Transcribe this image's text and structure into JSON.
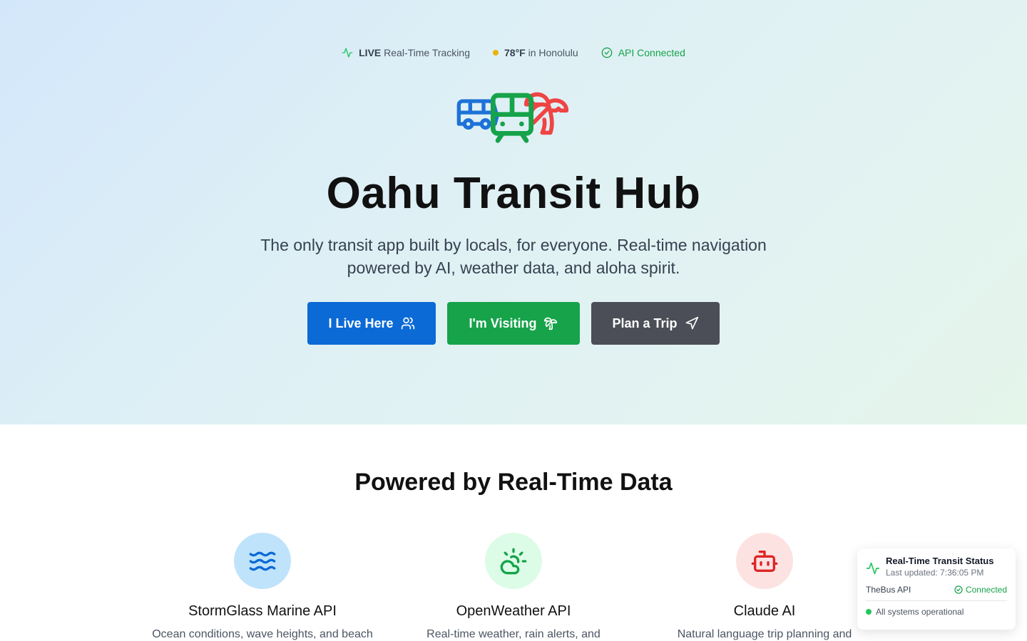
{
  "status_strip": {
    "live_label": "LIVE",
    "live_text": "Real-Time Tracking",
    "weather_temp": "78°F",
    "weather_text": "in Honolulu",
    "api_status": "API Connected"
  },
  "hero": {
    "title": "Oahu Transit Hub",
    "subtitle": "The only transit app built by locals, for everyone. Real-time navigation powered by AI, weather data, and aloha spirit.",
    "buttons": [
      {
        "label": "I Live Here",
        "icon": "users-icon"
      },
      {
        "label": "I'm Visiting",
        "icon": "palm-tree-icon"
      },
      {
        "label": "Plan a Trip",
        "icon": "send-icon"
      }
    ]
  },
  "data_section": {
    "title": "Powered by Real-Time Data",
    "features": [
      {
        "title": "StormGlass Marine API",
        "desc": "Ocean conditions, wave heights, and beach",
        "icon": "waves-icon"
      },
      {
        "title": "OpenWeather API",
        "desc": "Real-time weather, rain alerts, and",
        "icon": "cloud-sun-icon"
      },
      {
        "title": "Claude AI",
        "desc": "Natural language trip planning and",
        "icon": "bot-icon"
      }
    ]
  },
  "status_card": {
    "title": "Real-Time Transit Status",
    "updated": "Last updated: 7:36:05 PM",
    "service": "TheBus API",
    "service_status": "Connected",
    "summary": "All systems operational"
  },
  "colors": {
    "primary_blue": "#0b6ad6",
    "success_green": "#16a34a",
    "dark_gray": "#4b4e56",
    "palm_red": "#ef4444"
  }
}
